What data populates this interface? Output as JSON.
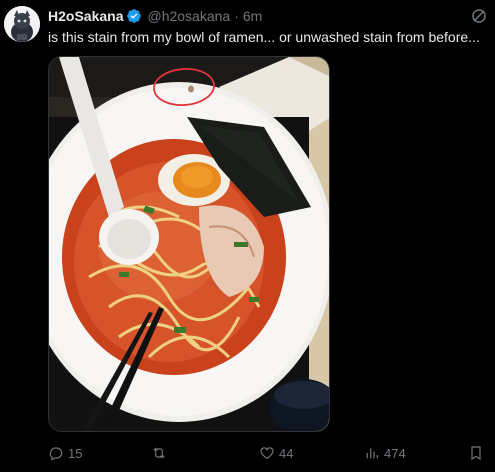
{
  "tweet": {
    "display_name": "H2oSakana",
    "handle": "@h2osakana",
    "separator": "·",
    "time": "6m",
    "text": "is this stain from my bowl of ramen... or unwashed stain from before...",
    "avatar_icon": "anime-character-avatar",
    "verified_icon": "verified-badge-icon",
    "menu_icon": "grok-icon",
    "media": {
      "description_icon": "ramen-bowl-photo",
      "annotation": "red circle around stain"
    }
  },
  "actions": {
    "reply_count": "15",
    "retweet_count": "",
    "like_count": "44",
    "view_count": "474"
  },
  "colors": {
    "background": "#000000",
    "text": "#e7e9ea",
    "muted": "#71767b",
    "verified": "#1d9bf0",
    "annotation": "#e0343c"
  }
}
